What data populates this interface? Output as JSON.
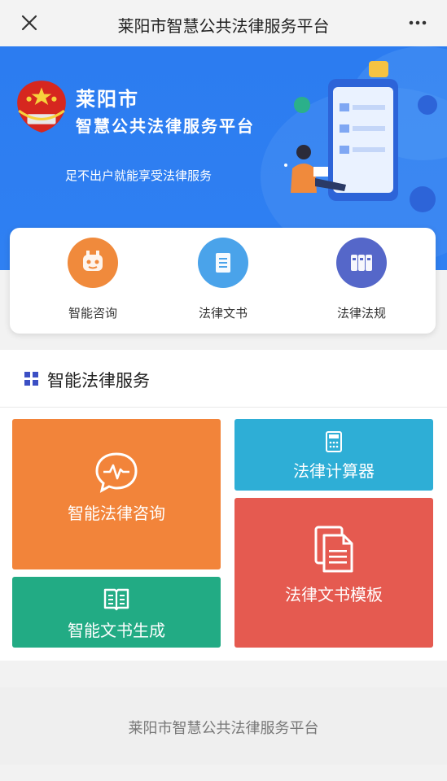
{
  "topbar": {
    "title": "莱阳市智慧公共法律服务平台"
  },
  "banner": {
    "brand_line1": "莱阳市",
    "brand_line2": "智慧公共法律服务平台",
    "slogan": "足不出户就能享受法律服务",
    "color": "#2f80f2"
  },
  "quick_links": [
    {
      "label": "智能咨询",
      "icon": "robot-icon",
      "color": "#f08a3c"
    },
    {
      "label": "法律文书",
      "icon": "document-icon",
      "color": "#4aa3ea"
    },
    {
      "label": "法律法规",
      "icon": "books-icon",
      "color": "#5567c9"
    }
  ],
  "service_section": {
    "title": "智能法律服务",
    "tiles": [
      {
        "label": "智能法律咨询",
        "icon": "chat-heartbeat-icon",
        "color": "#f2843a"
      },
      {
        "label": "法律计算器",
        "icon": "calculator-icon",
        "color": "#2eaed6"
      },
      {
        "label": "法律文书模板",
        "icon": "files-icon",
        "color": "#e55a50"
      },
      {
        "label": "智能文书生成",
        "icon": "book-icon",
        "color": "#22ab84"
      }
    ]
  },
  "footer": {
    "text": "莱阳市智慧公共法律服务平台"
  }
}
